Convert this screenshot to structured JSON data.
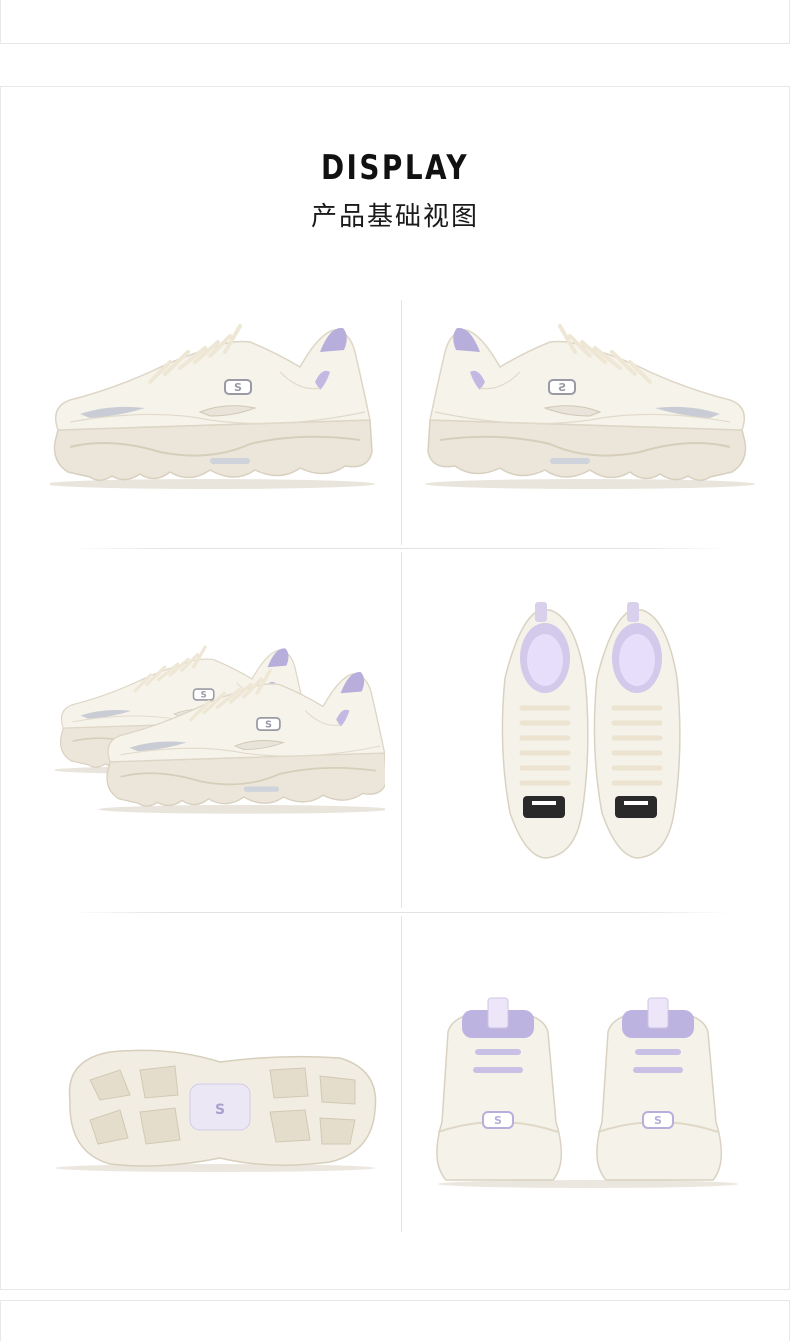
{
  "header": {
    "title": "DISPLAY",
    "subtitle": "产品基础视图"
  },
  "colors": {
    "shoe_body": "#f4f0e6",
    "shoe_shadow": "#ded7c7",
    "accent_lavender": "#b3a9d6",
    "logo_gray": "#8e8e96",
    "divider": "#e2e2e2"
  },
  "views": [
    {
      "name": "side-view-outer"
    },
    {
      "name": "side-view-inner"
    },
    {
      "name": "pair-angle-view"
    },
    {
      "name": "top-view"
    },
    {
      "name": "sole-view"
    },
    {
      "name": "back-view"
    }
  ]
}
